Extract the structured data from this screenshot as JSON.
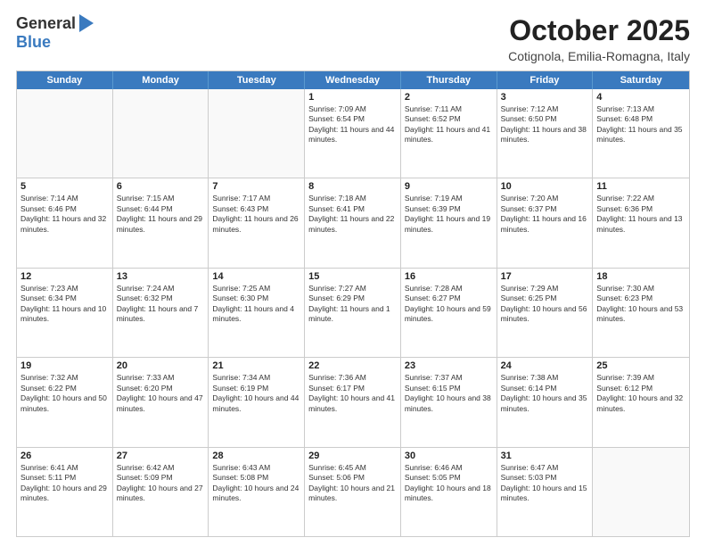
{
  "logo": {
    "general": "General",
    "blue": "Blue"
  },
  "header": {
    "month": "October 2025",
    "location": "Cotignola, Emilia-Romagna, Italy"
  },
  "days_of_week": [
    "Sunday",
    "Monday",
    "Tuesday",
    "Wednesday",
    "Thursday",
    "Friday",
    "Saturday"
  ],
  "weeks": [
    [
      {
        "day": "",
        "empty": true
      },
      {
        "day": "",
        "empty": true
      },
      {
        "day": "",
        "empty": true
      },
      {
        "day": "1",
        "sunrise": "7:09 AM",
        "sunset": "6:54 PM",
        "daylight": "11 hours and 44 minutes."
      },
      {
        "day": "2",
        "sunrise": "7:11 AM",
        "sunset": "6:52 PM",
        "daylight": "11 hours and 41 minutes."
      },
      {
        "day": "3",
        "sunrise": "7:12 AM",
        "sunset": "6:50 PM",
        "daylight": "11 hours and 38 minutes."
      },
      {
        "day": "4",
        "sunrise": "7:13 AM",
        "sunset": "6:48 PM",
        "daylight": "11 hours and 35 minutes."
      }
    ],
    [
      {
        "day": "5",
        "sunrise": "7:14 AM",
        "sunset": "6:46 PM",
        "daylight": "11 hours and 32 minutes."
      },
      {
        "day": "6",
        "sunrise": "7:15 AM",
        "sunset": "6:44 PM",
        "daylight": "11 hours and 29 minutes."
      },
      {
        "day": "7",
        "sunrise": "7:17 AM",
        "sunset": "6:43 PM",
        "daylight": "11 hours and 26 minutes."
      },
      {
        "day": "8",
        "sunrise": "7:18 AM",
        "sunset": "6:41 PM",
        "daylight": "11 hours and 22 minutes."
      },
      {
        "day": "9",
        "sunrise": "7:19 AM",
        "sunset": "6:39 PM",
        "daylight": "11 hours and 19 minutes."
      },
      {
        "day": "10",
        "sunrise": "7:20 AM",
        "sunset": "6:37 PM",
        "daylight": "11 hours and 16 minutes."
      },
      {
        "day": "11",
        "sunrise": "7:22 AM",
        "sunset": "6:36 PM",
        "daylight": "11 hours and 13 minutes."
      }
    ],
    [
      {
        "day": "12",
        "sunrise": "7:23 AM",
        "sunset": "6:34 PM",
        "daylight": "11 hours and 10 minutes."
      },
      {
        "day": "13",
        "sunrise": "7:24 AM",
        "sunset": "6:32 PM",
        "daylight": "11 hours and 7 minutes."
      },
      {
        "day": "14",
        "sunrise": "7:25 AM",
        "sunset": "6:30 PM",
        "daylight": "11 hours and 4 minutes."
      },
      {
        "day": "15",
        "sunrise": "7:27 AM",
        "sunset": "6:29 PM",
        "daylight": "11 hours and 1 minute."
      },
      {
        "day": "16",
        "sunrise": "7:28 AM",
        "sunset": "6:27 PM",
        "daylight": "10 hours and 59 minutes."
      },
      {
        "day": "17",
        "sunrise": "7:29 AM",
        "sunset": "6:25 PM",
        "daylight": "10 hours and 56 minutes."
      },
      {
        "day": "18",
        "sunrise": "7:30 AM",
        "sunset": "6:23 PM",
        "daylight": "10 hours and 53 minutes."
      }
    ],
    [
      {
        "day": "19",
        "sunrise": "7:32 AM",
        "sunset": "6:22 PM",
        "daylight": "10 hours and 50 minutes."
      },
      {
        "day": "20",
        "sunrise": "7:33 AM",
        "sunset": "6:20 PM",
        "daylight": "10 hours and 47 minutes."
      },
      {
        "day": "21",
        "sunrise": "7:34 AM",
        "sunset": "6:19 PM",
        "daylight": "10 hours and 44 minutes."
      },
      {
        "day": "22",
        "sunrise": "7:36 AM",
        "sunset": "6:17 PM",
        "daylight": "10 hours and 41 minutes."
      },
      {
        "day": "23",
        "sunrise": "7:37 AM",
        "sunset": "6:15 PM",
        "daylight": "10 hours and 38 minutes."
      },
      {
        "day": "24",
        "sunrise": "7:38 AM",
        "sunset": "6:14 PM",
        "daylight": "10 hours and 35 minutes."
      },
      {
        "day": "25",
        "sunrise": "7:39 AM",
        "sunset": "6:12 PM",
        "daylight": "10 hours and 32 minutes."
      }
    ],
    [
      {
        "day": "26",
        "sunrise": "6:41 AM",
        "sunset": "5:11 PM",
        "daylight": "10 hours and 29 minutes."
      },
      {
        "day": "27",
        "sunrise": "6:42 AM",
        "sunset": "5:09 PM",
        "daylight": "10 hours and 27 minutes."
      },
      {
        "day": "28",
        "sunrise": "6:43 AM",
        "sunset": "5:08 PM",
        "daylight": "10 hours and 24 minutes."
      },
      {
        "day": "29",
        "sunrise": "6:45 AM",
        "sunset": "5:06 PM",
        "daylight": "10 hours and 21 minutes."
      },
      {
        "day": "30",
        "sunrise": "6:46 AM",
        "sunset": "5:05 PM",
        "daylight": "10 hours and 18 minutes."
      },
      {
        "day": "31",
        "sunrise": "6:47 AM",
        "sunset": "5:03 PM",
        "daylight": "10 hours and 15 minutes."
      },
      {
        "day": "",
        "empty": true
      }
    ]
  ]
}
